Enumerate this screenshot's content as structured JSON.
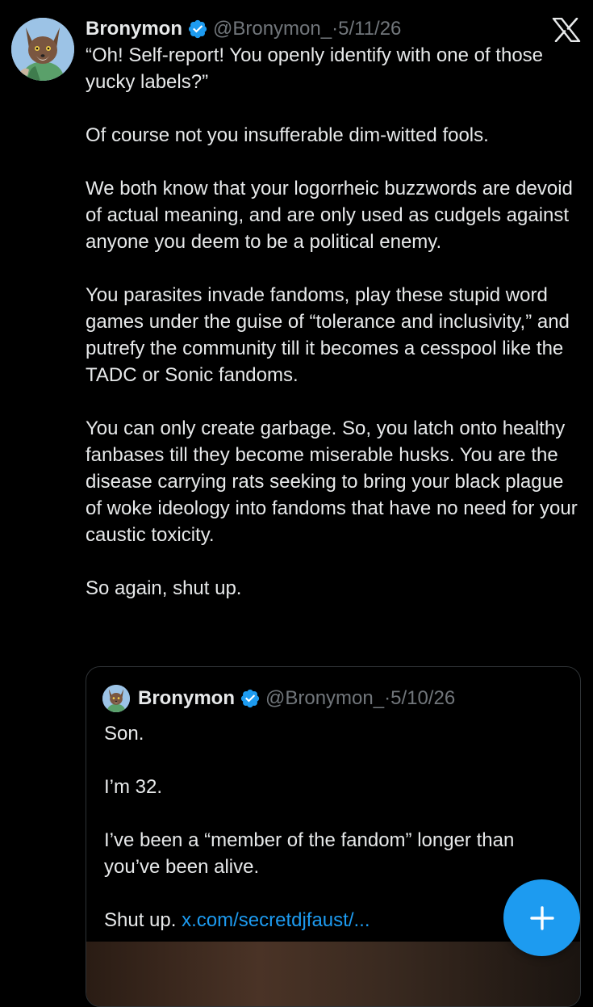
{
  "tweet": {
    "author": {
      "name": "Bronymon",
      "handle": "@Bronymon_",
      "separator": "·",
      "date": "5/11/26",
      "verified": true,
      "avatar_icon": "fox-avatar"
    },
    "paragraphs": [
      "“Oh! Self-report! You openly identify with one of those yucky labels?”",
      "Of course not you insufferable dim-witted fools.",
      "We both know that your logorrheic buzzwords are devoid of actual meaning, and are only used as cudgels against anyone you deem to be a political enemy.",
      "You parasites invade fandoms, play these stupid word games under the guise of “tolerance and inclusivity,” and putrefy the community till it becomes a cesspool like the TADC or Sonic fandoms.",
      "You can only create garbage. So, you latch onto healthy fanbases till they become miserable husks. You are the disease carrying rats seeking to bring your black plague of woke ideology into fandoms that have no need for your caustic toxicity.",
      "So again, shut up."
    ]
  },
  "quoted_tweet": {
    "author": {
      "name": "Bronymon",
      "handle": "@Bronymon_",
      "separator": "·",
      "date": "5/10/26",
      "verified": true
    },
    "paragraphs": [
      "Son.",
      "I’m 32.",
      "I’ve been a “member of the fandom” longer than you’ve been alive."
    ],
    "last_line_text": "Shut up.",
    "link_text": "x.com/secretdjfaust/..."
  },
  "ui": {
    "close_icon": "x-logo-icon",
    "compose_icon": "plus-icon"
  },
  "colors": {
    "background": "#000000",
    "text": "#e7e9ea",
    "secondary_text": "#71767b",
    "accent": "#1d9bf0",
    "border": "#2f3336"
  }
}
